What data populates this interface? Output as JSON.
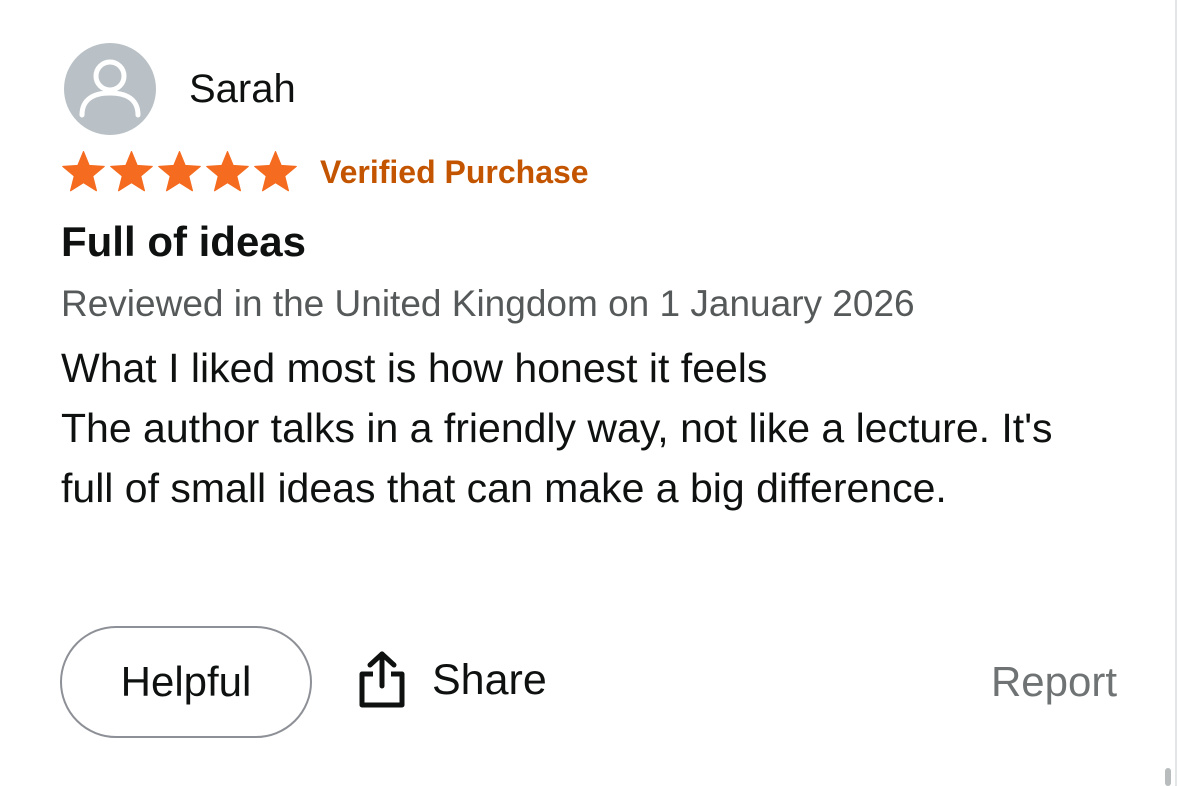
{
  "review": {
    "author": "Sarah",
    "rating": 5,
    "rating_max": 5,
    "verified_label": "Verified Purchase",
    "title": "Full of ideas",
    "meta": "Reviewed in the United Kingdom on 1 January 2026",
    "body_lines": [
      "What I liked most is how honest it feels",
      "The author talks in a friendly way, not like a lecture. It's full of small ideas that can make a big difference."
    ]
  },
  "actions": {
    "helpful_label": "Helpful",
    "share_label": "Share",
    "report_label": "Report"
  },
  "icons": {
    "avatar": "user-silhouette-icon",
    "star": "star-icon",
    "share": "share-upload-icon"
  },
  "colors": {
    "star": "#f56b1f",
    "verified": "#c45500",
    "meta_text": "#565959",
    "avatar_bg": "#b9c1c6"
  }
}
